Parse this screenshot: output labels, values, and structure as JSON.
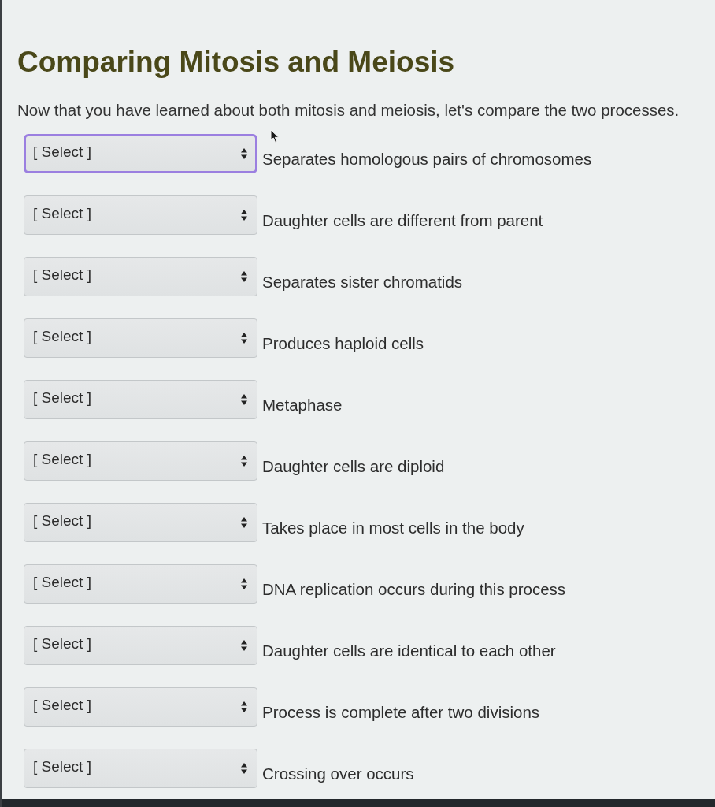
{
  "page": {
    "title": "Comparing Mitosis and Meiosis",
    "intro": "Now that you have learned about both mitosis and meiosis, let's compare the two processes."
  },
  "questions": [
    {
      "value": "[ Select ]",
      "focused": true,
      "statement": "Separates homologous pairs of chromosomes"
    },
    {
      "value": "[ Select ]",
      "focused": false,
      "statement": "Daughter cells are different from parent"
    },
    {
      "value": "[ Select ]",
      "focused": false,
      "statement": "Separates sister chromatids"
    },
    {
      "value": "[ Select ]",
      "focused": false,
      "statement": "Produces haploid cells"
    },
    {
      "value": "[ Select ]",
      "focused": false,
      "statement": "Metaphase"
    },
    {
      "value": "[ Select ]",
      "focused": false,
      "statement": "Daughter cells are diploid"
    },
    {
      "value": "[ Select ]",
      "focused": false,
      "statement": "Takes place in most cells in the body"
    },
    {
      "value": "[ Select ]",
      "focused": false,
      "statement": "DNA replication occurs during this process"
    },
    {
      "value": "[ Select ]",
      "focused": false,
      "statement": "Daughter cells are identical to each other"
    },
    {
      "value": "[ Select ]",
      "focused": false,
      "statement": "Process is complete after two divisions"
    },
    {
      "value": "[ Select ]",
      "focused": false,
      "statement": "Crossing over occurs"
    }
  ]
}
